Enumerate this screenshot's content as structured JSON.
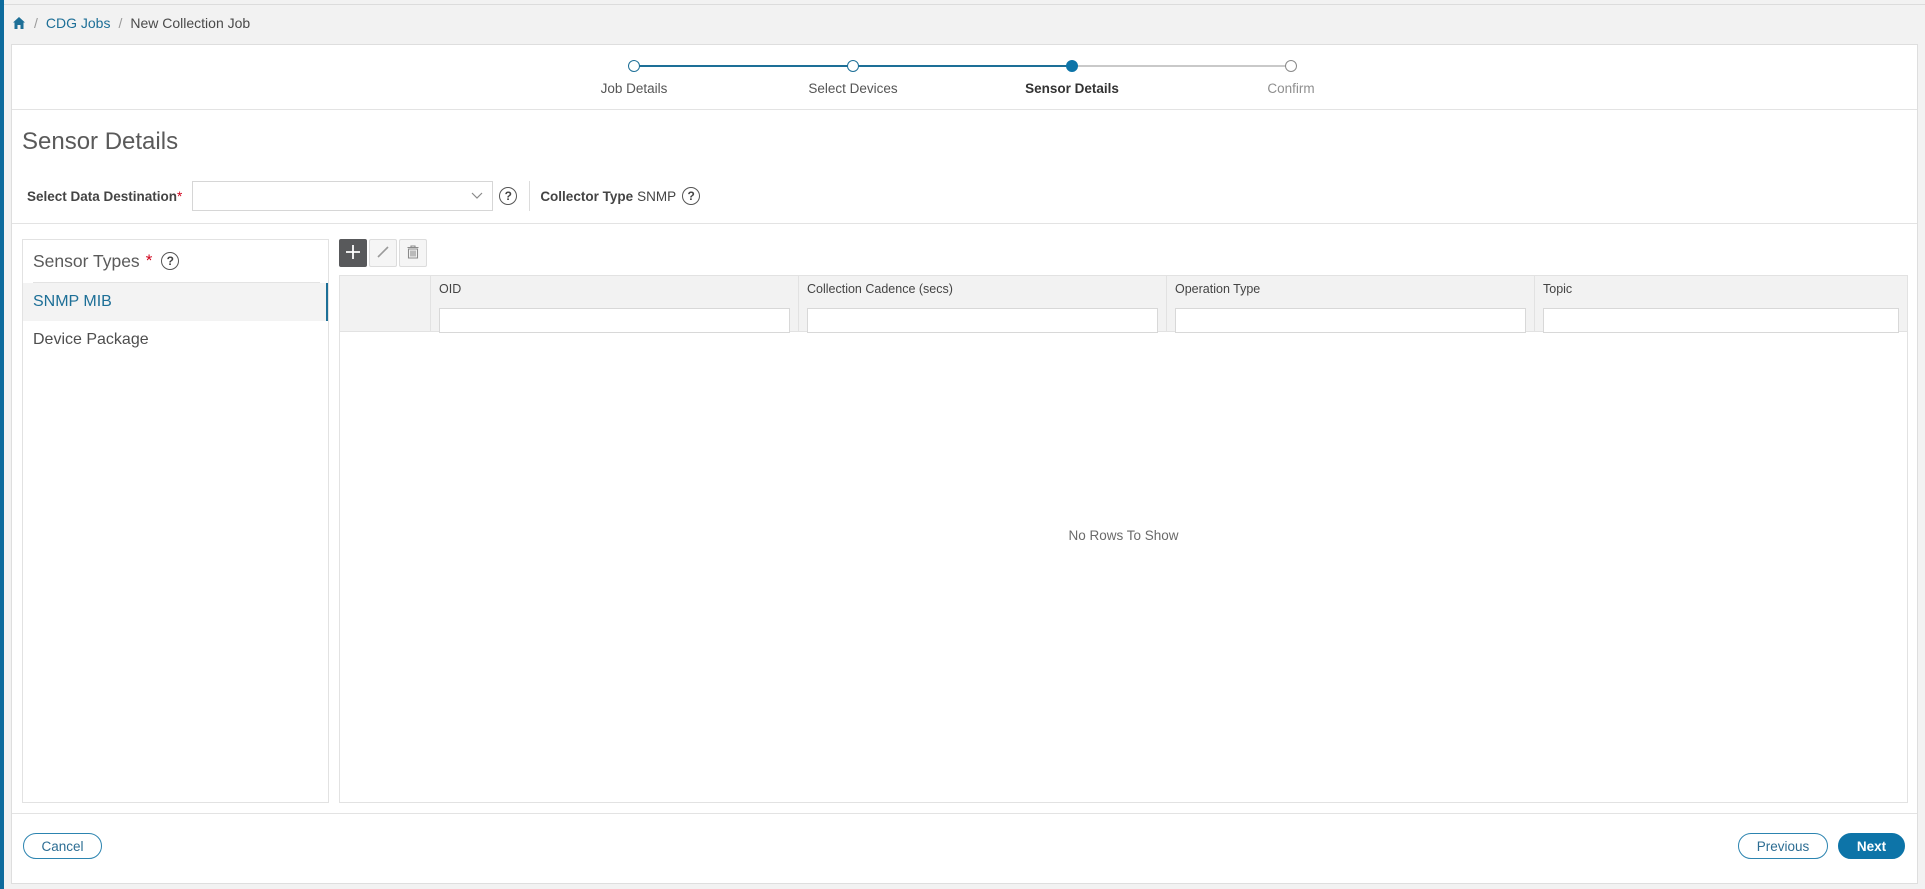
{
  "breadcrumb": {
    "home_icon": "home-icon",
    "items": [
      "CDG Jobs",
      "New Collection Job"
    ],
    "separator": "/"
  },
  "stepper": {
    "steps": [
      {
        "label": "Job Details",
        "state": "complete"
      },
      {
        "label": "Select Devices",
        "state": "complete"
      },
      {
        "label": "Sensor Details",
        "state": "active"
      },
      {
        "label": "Confirm",
        "state": "future"
      }
    ]
  },
  "page": {
    "title": "Sensor Details"
  },
  "destination": {
    "label": "Select Data Destination",
    "required_mark": "*",
    "value": "",
    "help_icon": "question-circle-icon"
  },
  "collector": {
    "label": "Collector Type",
    "value": "SNMP",
    "help_icon": "question-circle-icon"
  },
  "sensor_types": {
    "title": "Sensor Types",
    "required_mark": "*",
    "help_glyph": "?",
    "items": [
      {
        "label": "SNMP MIB",
        "selected": true
      },
      {
        "label": "Device Package",
        "selected": false
      }
    ]
  },
  "toolbar": {
    "add_icon": "plus-icon",
    "edit_icon": "pencil-icon",
    "delete_icon": "trash-icon"
  },
  "grid": {
    "columns": [
      {
        "title": "OID",
        "filter": ""
      },
      {
        "title": "Collection Cadence (secs)",
        "filter": ""
      },
      {
        "title": "Operation Type",
        "filter": ""
      },
      {
        "title": "Topic",
        "filter": ""
      }
    ],
    "rows": [],
    "empty_text": "No Rows To Show"
  },
  "footer": {
    "cancel_label": "Cancel",
    "previous_label": "Previous",
    "next_label": "Next"
  },
  "colors": {
    "accent": "#0d74a8",
    "link": "#1d6f97",
    "required": "#d0021b"
  },
  "help_glyph": "?"
}
